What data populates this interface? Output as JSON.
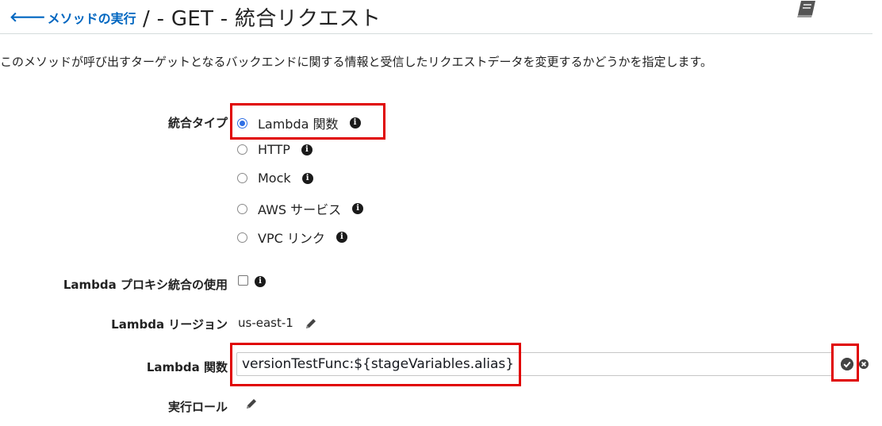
{
  "header": {
    "back_link": "メソッドの実行",
    "title": "/ - GET - 統合リクエスト"
  },
  "description": "このメソッドが呼び出すターゲットとなるバックエンドに関する情報と受信したリクエストデータを変更するかどうかを指定します。",
  "integration_type": {
    "label": "統合タイプ",
    "options": [
      {
        "label": "Lambda 関数",
        "selected": true
      },
      {
        "label": "HTTP",
        "selected": false
      },
      {
        "label": "Mock",
        "selected": false
      },
      {
        "label": "AWS サービス",
        "selected": false
      },
      {
        "label": "VPC リンク",
        "selected": false
      }
    ]
  },
  "proxy": {
    "label": "Lambda プロキシ統合の使用",
    "checked": false
  },
  "region": {
    "label": "Lambda リージョン",
    "value": "us-east-1"
  },
  "lambda_function": {
    "label": "Lambda 関数",
    "value": "versionTestFunc:${stageVariables.alias}"
  },
  "execution_role": {
    "label": "実行ロール"
  },
  "colors": {
    "link": "#0066c0",
    "highlight": "#e00000",
    "radio_selected": "#2f6fe4"
  },
  "icons": {
    "back": "arrow-left-icon",
    "docs": "book-icon",
    "info": "info-icon",
    "edit": "pencil-icon",
    "confirm": "check-circle-icon",
    "cancel": "close-circle-icon"
  }
}
